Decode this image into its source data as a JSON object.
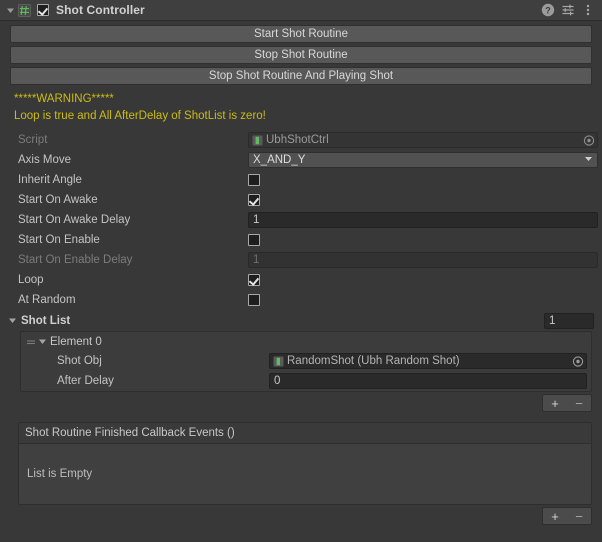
{
  "header": {
    "title": "Shot Controller",
    "enabled": true,
    "foldout_open": true,
    "script_icon": "csharp-script-icon",
    "icons": [
      {
        "name": "help-icon",
        "glyph": "?"
      },
      {
        "name": "preset-icon",
        "glyph": "sliders"
      },
      {
        "name": "more-menu-icon",
        "glyph": "kebab"
      }
    ]
  },
  "buttons": [
    {
      "label": "Start Shot Routine"
    },
    {
      "label": "Stop Shot Routine"
    },
    {
      "label": "Stop Shot Routine And Playing Shot"
    }
  ],
  "warning": {
    "color": "#cbbc14",
    "line1": "*****WARNING*****",
    "line2": "Loop is true and All AfterDelay of ShotList is zero!"
  },
  "properties": [
    {
      "label": "Script",
      "type": "object",
      "value": "UbhShotCtrl",
      "readonly": true,
      "icon": "script-asset-icon"
    },
    {
      "label": "Axis Move",
      "type": "enum",
      "value": "X_AND_Y"
    },
    {
      "label": "Inherit Angle",
      "type": "checkbox",
      "checked": false
    },
    {
      "label": "Start On Awake",
      "type": "checkbox",
      "checked": true
    },
    {
      "label": "Start On Awake Delay",
      "type": "number",
      "value": "1"
    },
    {
      "label": "Start On Enable",
      "type": "checkbox",
      "checked": false
    },
    {
      "label": "Start On Enable Delay",
      "type": "number",
      "value": "1",
      "disabled": true
    },
    {
      "label": "Loop",
      "type": "checkbox",
      "checked": true
    },
    {
      "label": "At Random",
      "type": "checkbox",
      "checked": false
    }
  ],
  "shot_list": {
    "title": "Shot List",
    "foldout_open": true,
    "size": "1",
    "element": {
      "label": "Element 0",
      "foldout_open": true,
      "fields": [
        {
          "label": "Shot Obj",
          "type": "object",
          "value": "RandomShot (Ubh Random Shot)",
          "icon": "prefab-asset-icon"
        },
        {
          "label": "After Delay",
          "type": "number",
          "value": "0"
        }
      ]
    },
    "add_label": "+",
    "remove_label": "−"
  },
  "unity_event": {
    "title": "Shot Routine Finished Callback Events ()",
    "empty_text": "List is Empty",
    "add_label": "+",
    "remove_label": "−"
  }
}
